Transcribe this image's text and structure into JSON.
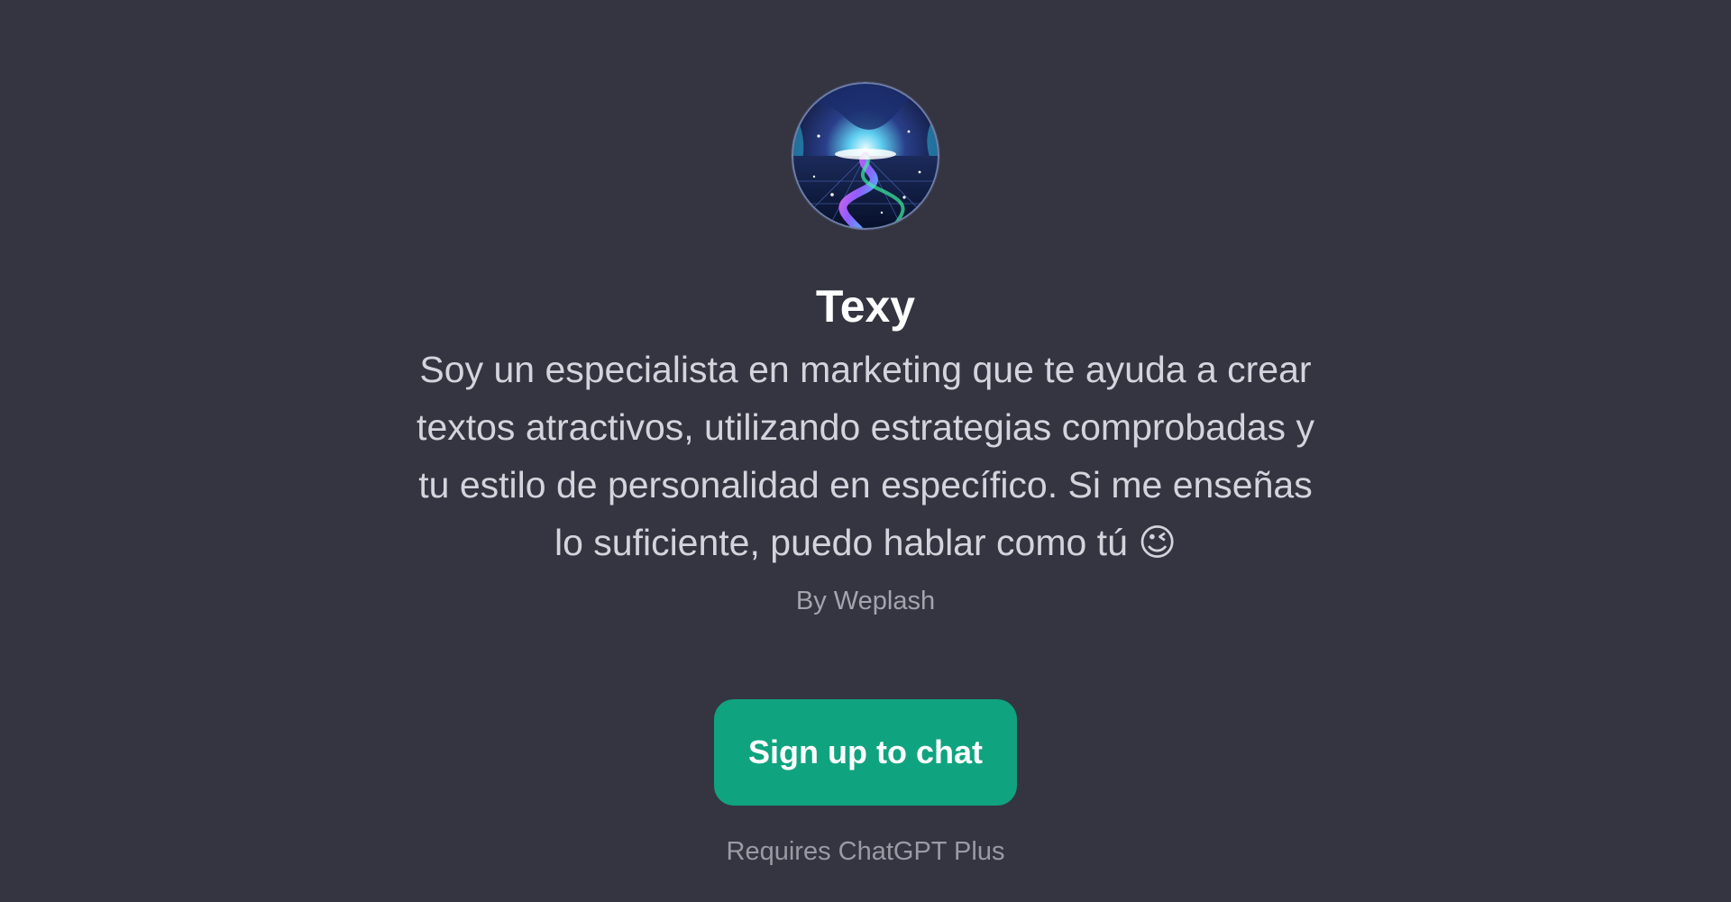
{
  "gpt": {
    "name": "Texy",
    "description": "Soy un especialista en marketing que te ayuda a crear textos atractivos, utilizando estrategias comprobadas y tu estilo de personalidad en específico. Si me enseñas lo suficiente, puedo hablar como tú 😉",
    "author": "By Weplash",
    "avatar_icon": "cosmic-landscape-avatar"
  },
  "actions": {
    "signup_label": "Sign up to chat"
  },
  "footer": {
    "text": "Requires ChatGPT Plus"
  },
  "colors": {
    "background": "#343541",
    "accent": "#10a37f"
  }
}
